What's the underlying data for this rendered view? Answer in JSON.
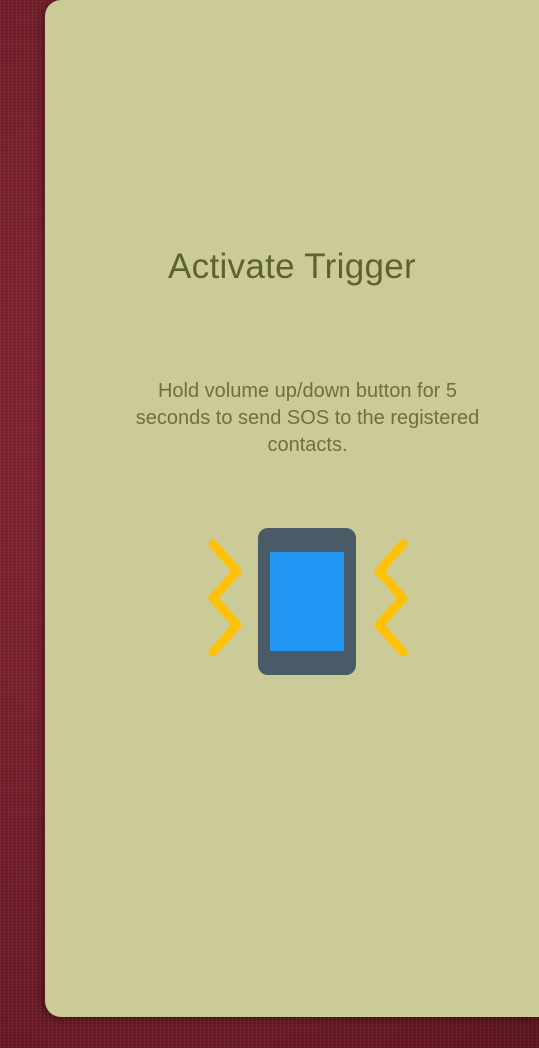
{
  "trigger_card": {
    "title": "Activate Trigger",
    "description": "Hold volume up/down button for 5 seconds to send SOS to the registered contacts.",
    "illustration_icon": "vibrating-phone-icon"
  },
  "colors": {
    "card_background": "#cbcb97",
    "title_text": "#5f6230",
    "body_text": "#6f7040",
    "phone_body": "#4a5a66",
    "phone_screen": "#2196f3",
    "vibration_lines": "#ffc107",
    "backdrop": "#7a1f2b"
  }
}
